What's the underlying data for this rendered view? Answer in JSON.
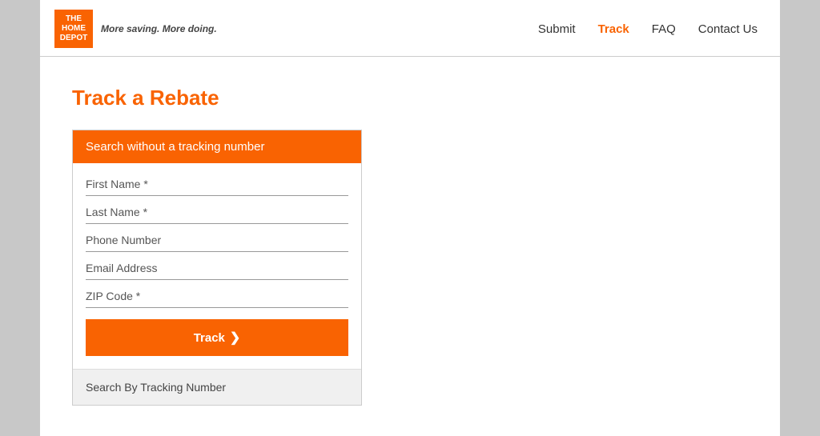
{
  "header": {
    "logo_text": "THE HOME DEPOT",
    "tagline_prefix": "More saving.",
    "tagline_suffix": "More doing.",
    "nav": [
      {
        "label": "Submit",
        "active": false
      },
      {
        "label": "Track",
        "active": true
      },
      {
        "label": "FAQ",
        "active": false
      },
      {
        "label": "Contact Us",
        "active": false
      }
    ]
  },
  "main": {
    "page_title": "Track a Rebate",
    "form_card": {
      "header_label": "Search without a tracking number",
      "fields": [
        {
          "placeholder": "First Name *"
        },
        {
          "placeholder": "Last Name *"
        },
        {
          "placeholder": "Phone Number"
        },
        {
          "placeholder": "Email Address"
        },
        {
          "placeholder": "ZIP Code *"
        }
      ],
      "track_button_label": "Track",
      "track_button_arrow": "❯",
      "alternate_search_label": "Search By Tracking Number"
    }
  }
}
